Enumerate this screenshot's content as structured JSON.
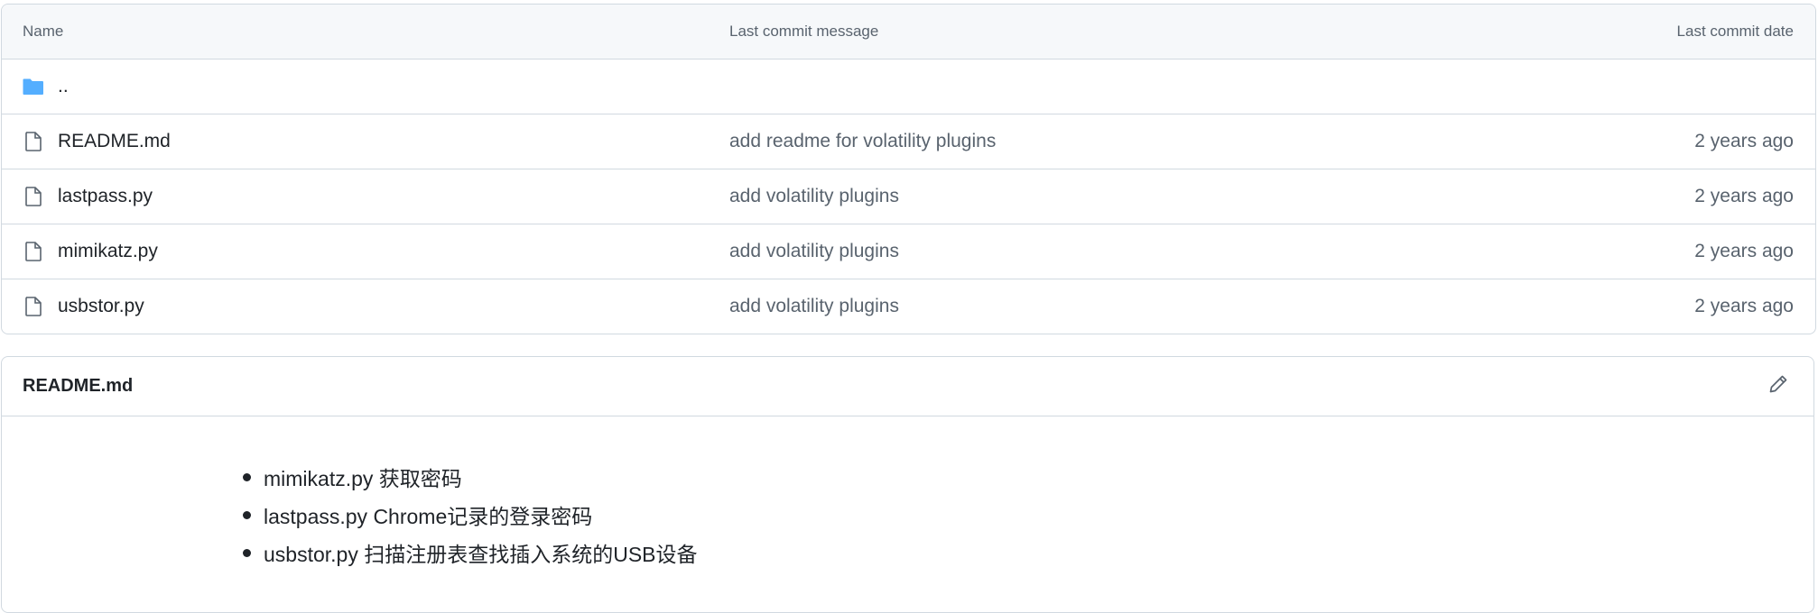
{
  "file_table": {
    "headers": {
      "name": "Name",
      "message": "Last commit message",
      "date": "Last commit date"
    },
    "parent": {
      "label": "..",
      "icon": "folder-icon",
      "icon_color": "#54aeff"
    },
    "files": [
      {
        "name": "README.md",
        "message": "add readme for volatility plugins",
        "date": "2 years ago",
        "icon": "file-icon"
      },
      {
        "name": "lastpass.py",
        "message": "add volatility plugins",
        "date": "2 years ago",
        "icon": "file-icon"
      },
      {
        "name": "mimikatz.py",
        "message": "add volatility plugins",
        "date": "2 years ago",
        "icon": "file-icon"
      },
      {
        "name": "usbstor.py",
        "message": "add volatility plugins",
        "date": "2 years ago",
        "icon": "file-icon"
      }
    ]
  },
  "readme": {
    "title": "README.md",
    "edit_icon": "pencil-icon",
    "items": [
      "mimikatz.py 获取密码",
      "lastpass.py Chrome记录的登录密码",
      "usbstor.py 扫描注册表查找插入系统的USB设备"
    ]
  },
  "colors": {
    "border": "#d1d9e0",
    "header_bg": "#f6f8fa",
    "muted_text": "#59636e",
    "text": "#1f2328",
    "folder": "#54aeff"
  }
}
